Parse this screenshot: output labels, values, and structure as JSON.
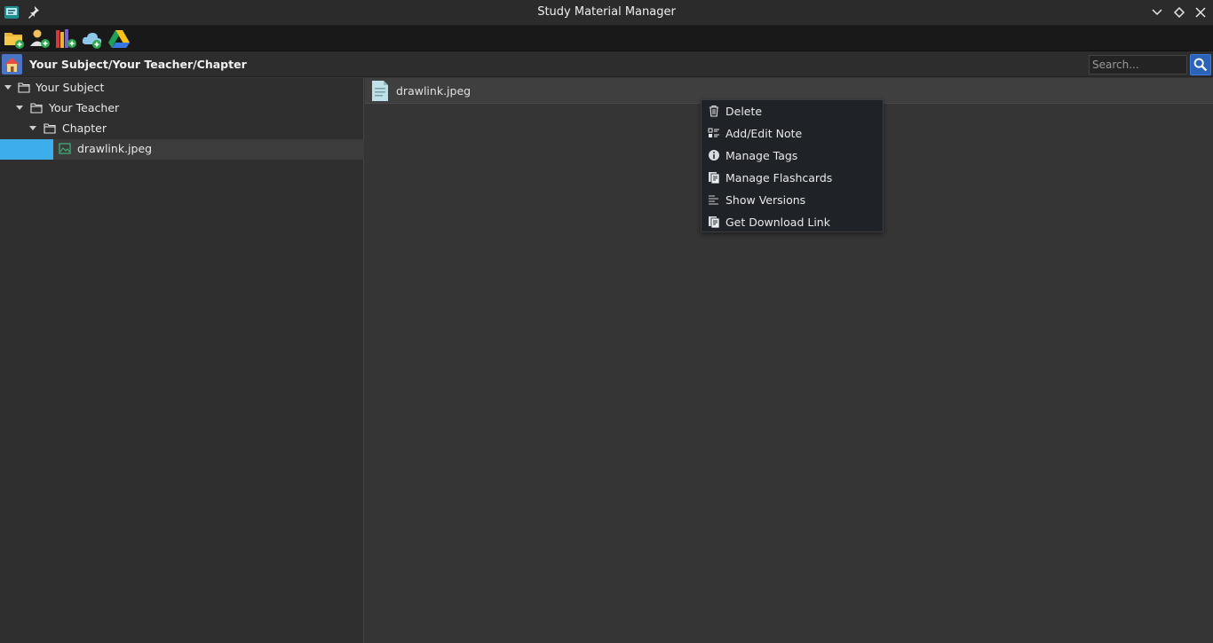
{
  "window": {
    "title": "Study Material Manager"
  },
  "toolbar": {
    "buttons": [
      {
        "icon": "folder-add-icon"
      },
      {
        "icon": "add-teacher-icon"
      },
      {
        "icon": "library-icon"
      },
      {
        "icon": "cloud-upload-icon"
      },
      {
        "icon": "google-drive-icon"
      }
    ]
  },
  "pathbar": {
    "path": "Your Subject/Your Teacher/Chapter",
    "search_placeholder": "Search..."
  },
  "tree": {
    "items": [
      {
        "label": "Your Subject",
        "level": 0,
        "type": "folder",
        "expanded": true
      },
      {
        "label": "Your Teacher",
        "level": 1,
        "type": "folder",
        "expanded": true
      },
      {
        "label": "Chapter",
        "level": 2,
        "type": "folder",
        "expanded": true
      },
      {
        "label": "drawlink.jpeg",
        "level": 3,
        "type": "image",
        "selected": true
      }
    ]
  },
  "content": {
    "file_label": "drawlink.jpeg"
  },
  "context_menu": {
    "items": [
      {
        "label": "Delete",
        "icon": "trash-icon"
      },
      {
        "label": "Add/Edit Note",
        "icon": "note-icon"
      },
      {
        "label": "Manage Tags",
        "icon": "info-icon"
      },
      {
        "label": "Manage Flashcards",
        "icon": "flashcards-icon"
      },
      {
        "label": "Show Versions",
        "icon": "versions-icon"
      },
      {
        "label": "Get Download Link",
        "icon": "download-link-icon"
      }
    ]
  },
  "colors": {
    "accent": "#3daee9",
    "search_button": "#2b63b8"
  }
}
